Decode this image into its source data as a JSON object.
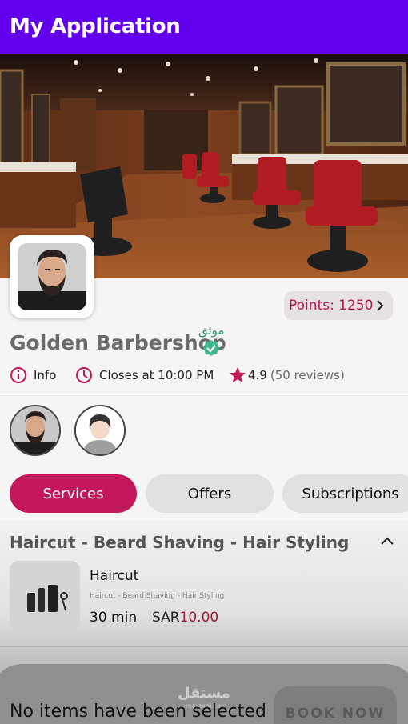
{
  "app": {
    "title": "My Application"
  },
  "shop": {
    "name": "Golden Barbershop",
    "trust_badge": "موثق",
    "points_label": "Points: 1250",
    "info_label": "Info",
    "closing_label": "Closes at 10:00 PM",
    "rating": "4.9",
    "reviews": "(50 reviews)"
  },
  "tabs": [
    {
      "label": "Services",
      "active": true
    },
    {
      "label": "Offers",
      "active": false
    },
    {
      "label": "Subscriptions",
      "active": false
    }
  ],
  "category": {
    "title": "Haircut - Beard Shaving - Hair Styling",
    "expanded": true
  },
  "services": [
    {
      "name": "Haircut",
      "description": "Haircut - Beard Shaving - Hair Styling",
      "duration": "30 min",
      "currency": "SAR",
      "price": "10.00"
    }
  ],
  "cart": {
    "empty_message": "No items have been selected",
    "book_label": "BOOK NOW"
  },
  "watermark": {
    "text": "مستقل",
    "sub": "mostaql.com"
  },
  "colors": {
    "app_bar": "#6200ee",
    "accent": "#c2185b",
    "points_text": "#b0154f",
    "price": "#9b1b30",
    "trust": "#2f8a6a"
  },
  "icons": [
    "info-icon",
    "clock-icon",
    "star-icon",
    "chevron-right-icon",
    "chevron-up-icon",
    "verified-check-icon"
  ]
}
